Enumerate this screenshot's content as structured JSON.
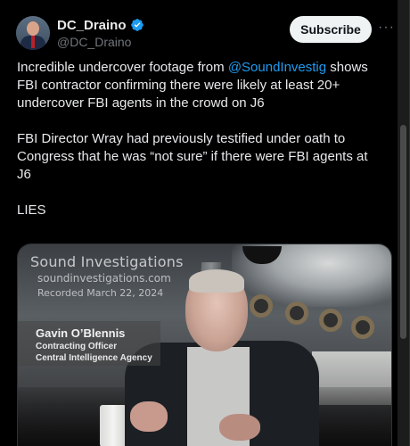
{
  "author": {
    "display_name": "DC_Draino",
    "handle": "@DC_Draino",
    "avatar_icon": "profile-avatar",
    "verified_icon": "verified-badge-icon",
    "verified_color": "#1d9bf0"
  },
  "actions": {
    "subscribe_label": "Subscribe",
    "more_icon": "more-options-icon",
    "more_glyph": "···"
  },
  "tweet": {
    "line1_before": "Incredible undercover footage from ",
    "mention": "@SoundInvestig",
    "line1_after": " shows FBI contractor confirming there were likely at least 20+ undercover FBI agents in the crowd on J6",
    "paragraph2": "FBI Director Wray had previously testified under oath to Congress that he was “not sure” if there were FBI agents at J6",
    "paragraph3": "LIES",
    "mention_color": "#1d9bf0"
  },
  "media": {
    "watermark_title": "Sound Investigations",
    "watermark_url": "soundinvestigations.com",
    "watermark_date": "Recorded March 22, 2024",
    "subject_name": "Gavin O’Blennis",
    "subject_role": "Contracting Officer",
    "subject_org": "Central Intelligence Agency"
  },
  "colors": {
    "background": "#000000",
    "text": "#e7e9ea",
    "secondary_text": "#71767b",
    "subscribe_bg": "#eff3f4"
  }
}
